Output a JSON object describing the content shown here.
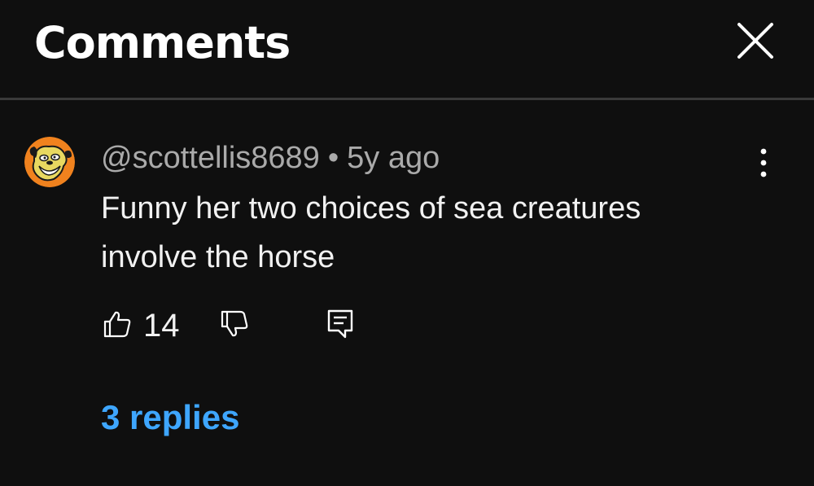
{
  "header": {
    "title": "Comments",
    "close_icon": "close-icon"
  },
  "comment": {
    "author": "@scottellis8689",
    "separator": "•",
    "age": "5y ago",
    "text": "Funny her two choices of sea creatures involve the horse",
    "likes": "14",
    "replies_label": "3 replies",
    "avatar_icon": "cartoon-dog-avatar",
    "more_icon": "more-vertical-icon",
    "like_icon": "thumbs-up-icon",
    "dislike_icon": "thumbs-down-icon",
    "reply_icon": "comment-reply-icon"
  },
  "colors": {
    "background": "#0f0f0f",
    "primary_text": "#f1f1f1",
    "secondary_text": "#aaaaaa",
    "link": "#3ea6ff",
    "divider": "#3a3a3a",
    "avatar_bg": "#f0821e",
    "avatar_face": "#e8d860"
  }
}
